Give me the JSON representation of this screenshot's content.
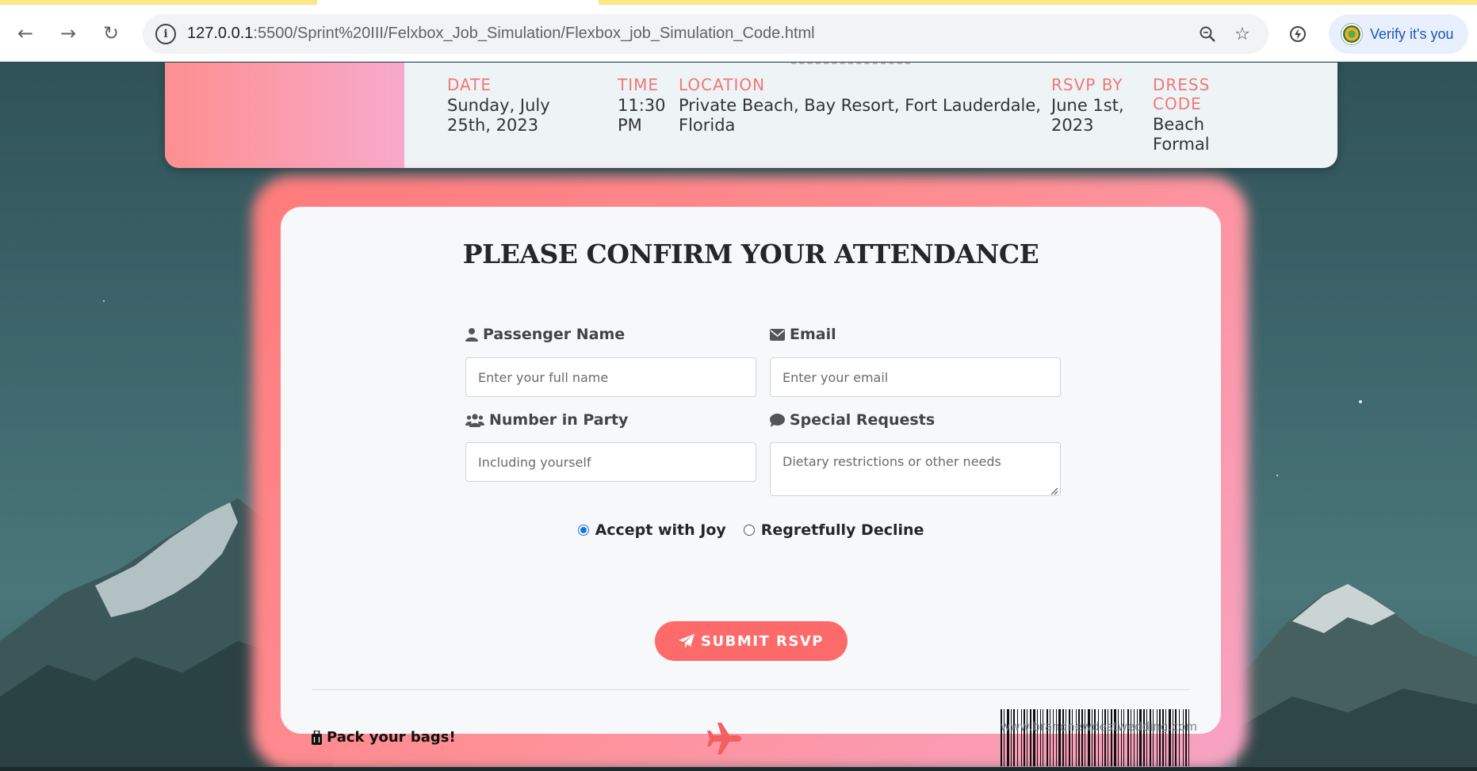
{
  "browser": {
    "url_host": "127.0.0.1",
    "url_path": ":5500/Sprint%20III/Felxbox_Job_Simulation/Flexbox_job_Simulation_Code.html",
    "verify_label": "Verify it's you"
  },
  "ticket": {
    "columns": [
      {
        "label": "DATE",
        "value": "Sunday, July 25th, 2023"
      },
      {
        "label": "TIME",
        "value": "11:30 PM"
      },
      {
        "label": "LOCATION",
        "value": "Private Beach, Bay Resort, Fort Lauderdale, Florida"
      },
      {
        "label": "RSVP BY",
        "value": "June 1st, 2023"
      },
      {
        "label": "DRESS CODE",
        "value": "Beach Formal"
      }
    ]
  },
  "rsvp": {
    "title": "PLEASE CONFIRM YOUR ATTENDANCE",
    "fields": {
      "name": {
        "label": "Passenger Name",
        "placeholder": "Enter your full name"
      },
      "email": {
        "label": "Email",
        "placeholder": "Enter your email"
      },
      "party": {
        "label": "Number in Party",
        "placeholder": "Including yourself"
      },
      "requests": {
        "label": "Special Requests",
        "placeholder": "Dietary restrictions or other needs"
      }
    },
    "options": {
      "accept": "Accept with Joy",
      "decline": "Regretfully Decline"
    },
    "selected_option": "accept",
    "submit_label": "SUBMIT RSVP",
    "footer_text": "Pack your bags!",
    "barcode_text": "www.brandnewdestwedding.com",
    "accent_color": "#fd6a6a"
  }
}
